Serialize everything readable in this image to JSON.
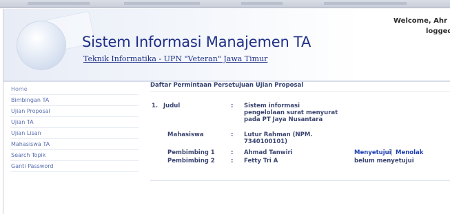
{
  "header": {
    "title": "Sistem Informasi Manajemen TA",
    "subtitle": "Teknik Informatika - UPN \"Veteran\" Jawa Timur",
    "welcome": "Welcome, Ahr",
    "logged": "logged"
  },
  "sidebar": {
    "items": [
      {
        "label": "Home"
      },
      {
        "label": "Bimbingan TA"
      },
      {
        "label": "Ujian Proposal"
      },
      {
        "label": "Ujian TA"
      },
      {
        "label": "Ujian Lisan"
      },
      {
        "label": "Mahasiswa TA"
      },
      {
        "label": "Search Topik"
      },
      {
        "label": "Ganti Password"
      }
    ]
  },
  "content": {
    "title": "Daftar Permintaan Persetujuan Ujian Proposal",
    "entry": {
      "number": "1.",
      "judul_label": "Judul",
      "judul_value": "Sistem informasi pengelolaan surat menyurat pada PT Jaya Nusantara",
      "mahasiswa_label": "Mahasiswa",
      "mahasiswa_value": "Lutur Rahman (NPM. 7340100101)",
      "pembimbing1_label": "Pembimbing 1",
      "pembimbing1_value": "Ahmad Tanwiri",
      "pembimbing2_label": "Pembimbing 2",
      "pembimbing2_value": "Fetty Tri A",
      "colon": ":",
      "action_approve": "Menyetujui",
      "action_separator": "|",
      "action_reject": "Menolak",
      "status_p2": "belum menyetujui"
    }
  }
}
